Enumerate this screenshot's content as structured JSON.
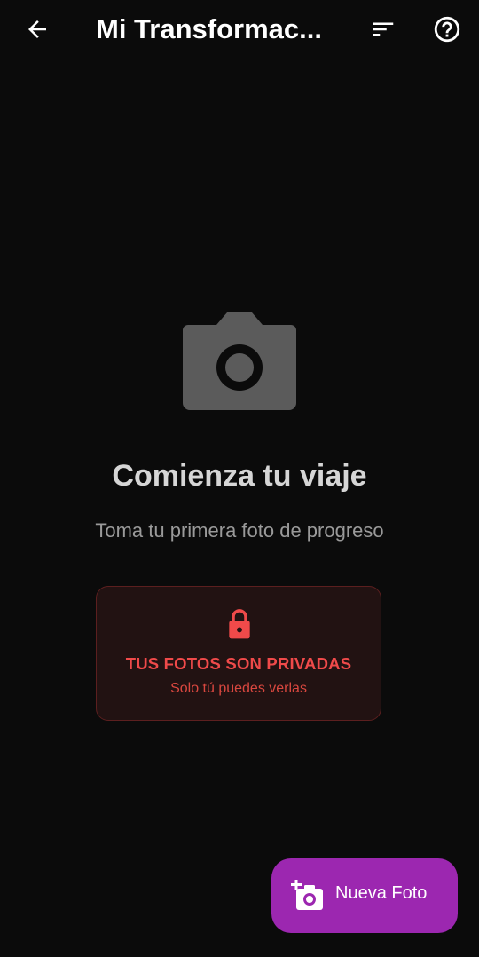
{
  "appbar": {
    "title": "Mi Transformac...",
    "back_icon": "arrow-left-icon",
    "filter_icon": "filter-icon",
    "help_icon": "help-circle-icon"
  },
  "empty_state": {
    "illustration_icon": "camera-icon",
    "title": "Comienza tu viaje",
    "subtitle": "Toma tu primera foto de progreso"
  },
  "privacy": {
    "icon": "lock-icon",
    "title": "TUS FOTOS SON PRIVADAS",
    "subtitle": "Solo tú puedes verlas"
  },
  "fab": {
    "icon": "add-photo-icon",
    "label": "Nueva Foto"
  },
  "colors": {
    "background": "#0b0b0b",
    "accent": "#9c27b0",
    "privacy_red": "#f04a4a"
  }
}
